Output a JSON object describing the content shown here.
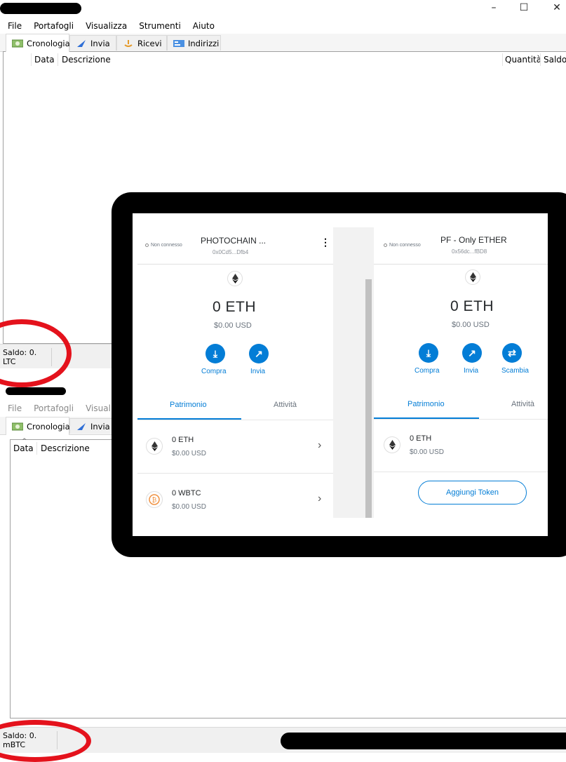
{
  "window1": {
    "menu": [
      "File",
      "Portafogli",
      "Visualizza",
      "Strumenti",
      "Aiuto"
    ],
    "tabs": [
      {
        "label": "Cronologia",
        "icon": "history-icon"
      },
      {
        "label": "Invia",
        "icon": "send-icon"
      },
      {
        "label": "Ricevi",
        "icon": "receive-icon"
      },
      {
        "label": "Indirizzi",
        "icon": "address-book-icon"
      }
    ],
    "columns": {
      "date": "Data",
      "description": "Descrizione",
      "amount": "Quantità",
      "balance": "Saldo"
    },
    "status_balance": "Saldo: 0. LTC"
  },
  "window2": {
    "menu": [
      "File",
      "Portafogli",
      "Visualizza"
    ],
    "tabs": [
      {
        "label": "Cronologia",
        "icon": "history-icon"
      },
      {
        "label": "Invia",
        "icon": "send-icon"
      }
    ],
    "columns": {
      "date": "Data",
      "description": "Descrizione"
    },
    "status_balance": "Saldo: 0. mBTC"
  },
  "metamask_left": {
    "status": "Non connesso",
    "account_name": "PHOTOCHAIN ...",
    "account_address": "0x0Cd5...Dfb4",
    "balance": "0 ETH",
    "balance_usd": "$0.00 USD",
    "actions": [
      "Compra",
      "Invia"
    ],
    "tabs": [
      "Patrimonio",
      "Attività"
    ],
    "assets": [
      {
        "amount": "0 ETH",
        "usd": "$0.00 USD",
        "icon": "ethereum-icon"
      },
      {
        "amount": "0 WBTC",
        "usd": "$0.00 USD",
        "icon": "bitcoin-icon"
      }
    ]
  },
  "metamask_right": {
    "status": "Non connesso",
    "account_name": "PF - Only ETHER",
    "account_address": "0x56dc...fBD8",
    "balance": "0 ETH",
    "balance_usd": "$0.00 USD",
    "actions": [
      "Compra",
      "Invia",
      "Scambia"
    ],
    "tabs": [
      "Patrimonio",
      "Attività"
    ],
    "assets": [
      {
        "amount": "0 ETH",
        "usd": "$0.00 USD",
        "icon": "ethereum-icon"
      }
    ],
    "add_token": "Aggiungi Token"
  },
  "colors": {
    "accent": "#037dd6",
    "highlight": "#e4121c"
  }
}
